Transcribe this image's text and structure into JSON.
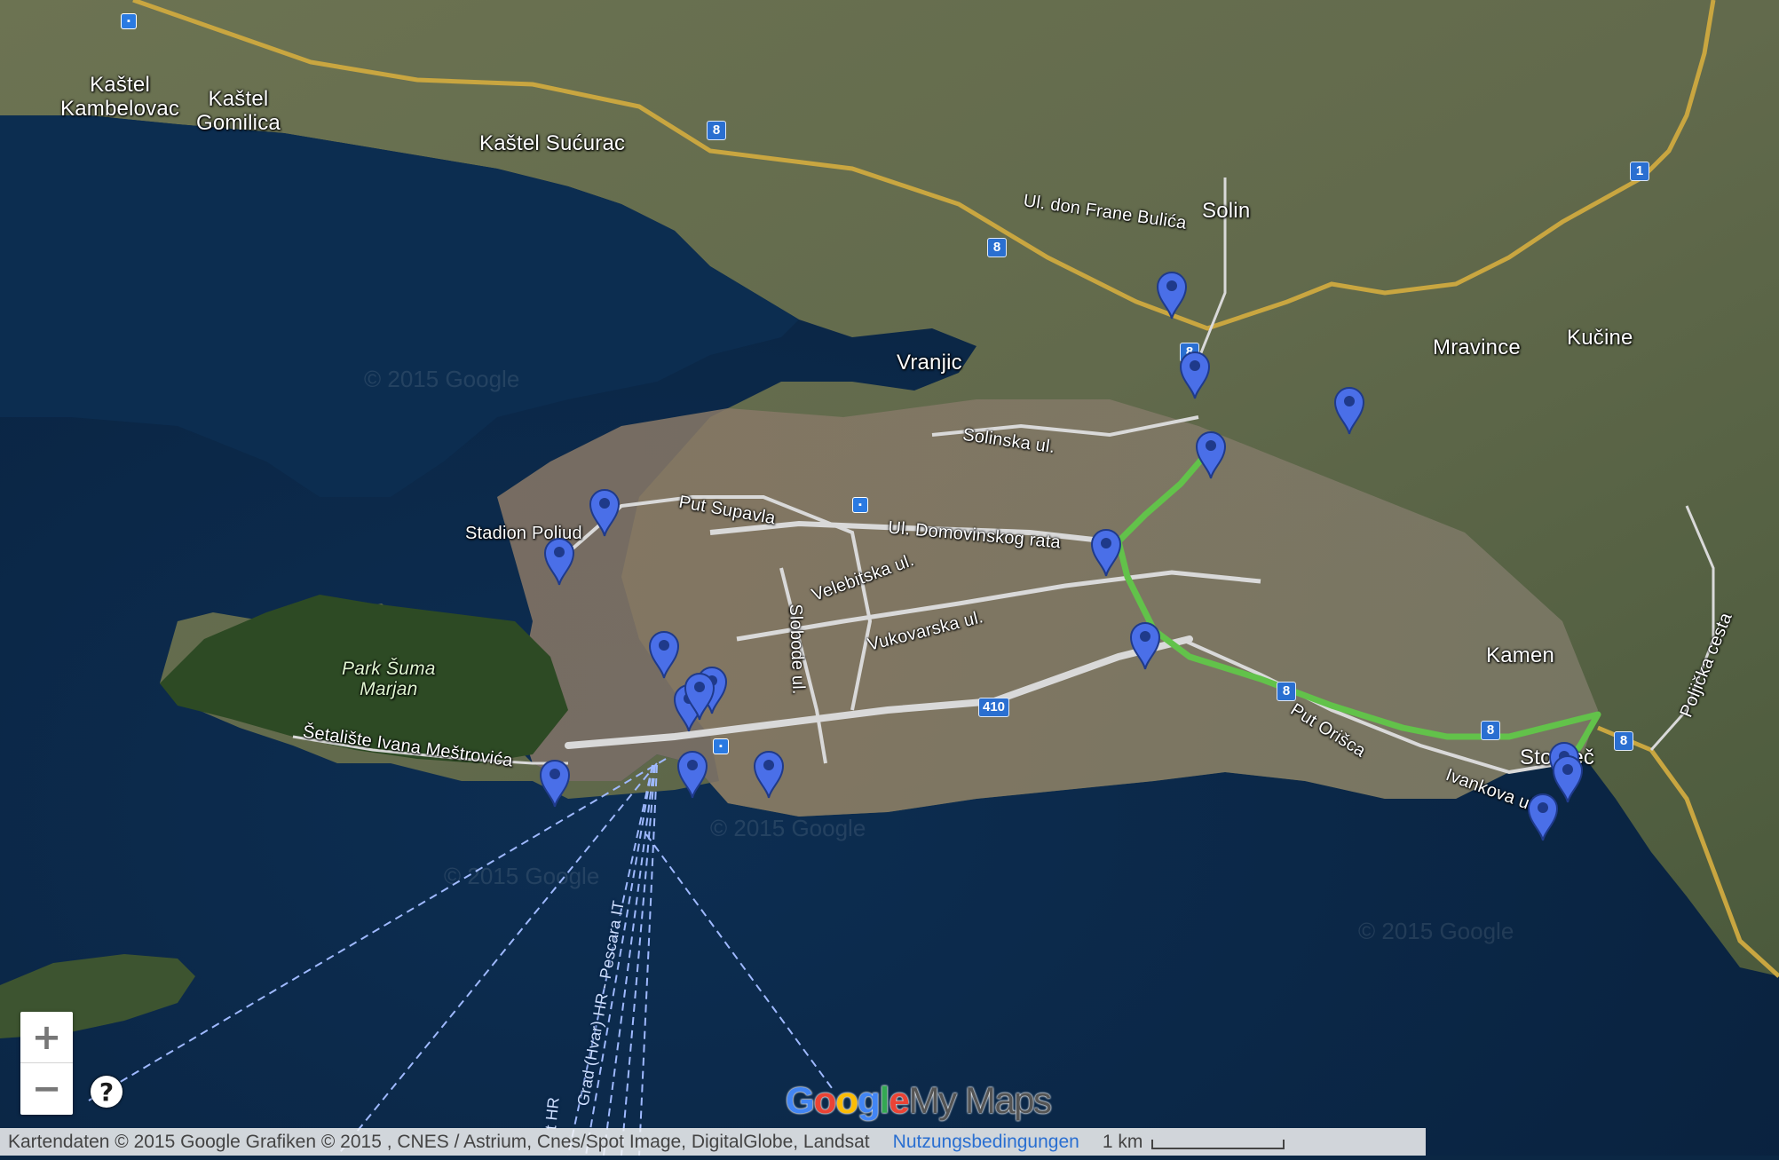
{
  "map": {
    "places": [
      {
        "name": "Kaštel\nKambelovac",
        "cls": "town"
      },
      {
        "name": "Kaštel\nGomilica",
        "cls": "town"
      },
      {
        "name": "Kaštel Sućurac",
        "cls": "town"
      },
      {
        "name": "Solin",
        "cls": "town"
      },
      {
        "name": "Vranjic",
        "cls": "town"
      },
      {
        "name": "Mravince",
        "cls": "town"
      },
      {
        "name": "Kučine",
        "cls": "town"
      },
      {
        "name": "Kamen",
        "cls": "town"
      },
      {
        "name": "Stobreč",
        "cls": "town"
      },
      {
        "name": "Stadion Poljud",
        "cls": "town"
      }
    ],
    "streets": [
      "Ul. don Frane Bulića",
      "Solinska ul.",
      "Put Supavla",
      "Ul. Domovinskog rata",
      "Velebitska ul.",
      "Vukovarska ul.",
      "Slobode ul.",
      "Šetalište Ivana Meštrovića",
      "Put Orišca",
      "Ivankova ul.",
      "Poljička cesta"
    ],
    "park": "Park Šuma\nMarjan",
    "ferry_labels": [
      "Grad (Hvar) HR - Pescara IT",
      "t HR"
    ],
    "route_shields": [
      "8",
      "8",
      "8",
      "8",
      "8",
      "8",
      "8",
      "1",
      "410"
    ],
    "watermark": "© 2015 Google",
    "marker_count": 18,
    "colors": {
      "sea": "#0b2744",
      "land": "#5f6a4a",
      "highway": "#c9a640",
      "road": "#d9d9d9",
      "route": "#62c24a",
      "marker": "#4a6fe8"
    }
  },
  "controls": {
    "zoom_in": "+",
    "zoom_out": "−",
    "help": "?"
  },
  "logo": {
    "google": [
      "G",
      "o",
      "o",
      "g",
      "l",
      "e"
    ],
    "mymaps": "My Maps"
  },
  "footer": {
    "attribution": "Kartendaten © 2015 Google Grafiken © 2015 , CNES / Astrium, Cnes/Spot Image, DigitalGlobe, Landsat",
    "terms": "Nutzungsbedingungen",
    "scale": "1 km"
  }
}
